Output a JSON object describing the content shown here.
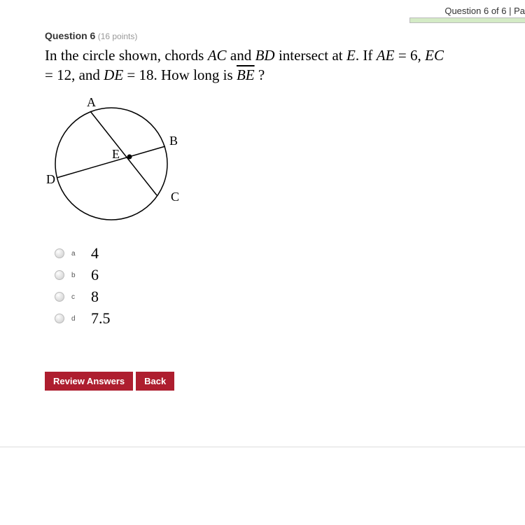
{
  "header": {
    "position_text": "Question 6 of 6 | Pa"
  },
  "question": {
    "label": "Question 6",
    "points_text": " (16 points)",
    "text_parts": {
      "p1": "In the circle shown, chords ",
      "ac": "AC",
      "p2": " and ",
      "bd": "BD",
      "p3": " intersect at ",
      "e": "E",
      "p4": ". If ",
      "ae": "AE",
      "p5": " = 6, ",
      "ec": "EC",
      "p6": " = 12, and ",
      "de": "DE",
      "p7": " = 18. How long is ",
      "be": "BE",
      "p8": " ?"
    }
  },
  "diagram": {
    "labels": {
      "A": "A",
      "B": "B",
      "C": "C",
      "D": "D",
      "E": "E"
    }
  },
  "options": [
    {
      "letter": "a",
      "value": "4"
    },
    {
      "letter": "b",
      "value": "6"
    },
    {
      "letter": "c",
      "value": "8"
    },
    {
      "letter": "d",
      "value": "7.5"
    }
  ],
  "buttons": {
    "review": "Review Answers",
    "back": "Back"
  }
}
